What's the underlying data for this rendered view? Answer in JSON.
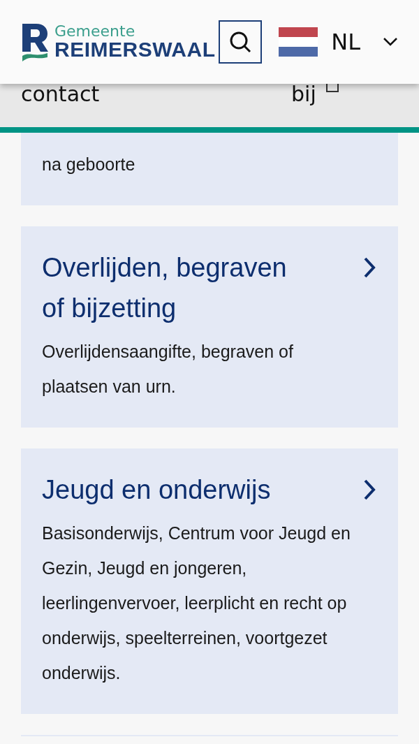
{
  "header": {
    "logo": {
      "top": "Gemeente",
      "bottom": "REIMERSWAAL"
    },
    "language": {
      "code": "NL"
    }
  },
  "subnav": {
    "items": [
      "contact",
      "bij"
    ]
  },
  "cards": [
    {
      "text": "na geboorte"
    },
    {
      "title": "Overlijden, begraven of bijzetting",
      "text": "Overlijdensaangifte, begraven of plaatsen van urn."
    },
    {
      "title": "Jeugd en onderwijs",
      "text": "Basisonderwijs, Centrum voor Jeugd en Gezin, Jeugd en jongeren, leerlingenvervoer, leerplicht en recht op onderwijs, speelterreinen, voortgezet onderwijs."
    }
  ]
}
